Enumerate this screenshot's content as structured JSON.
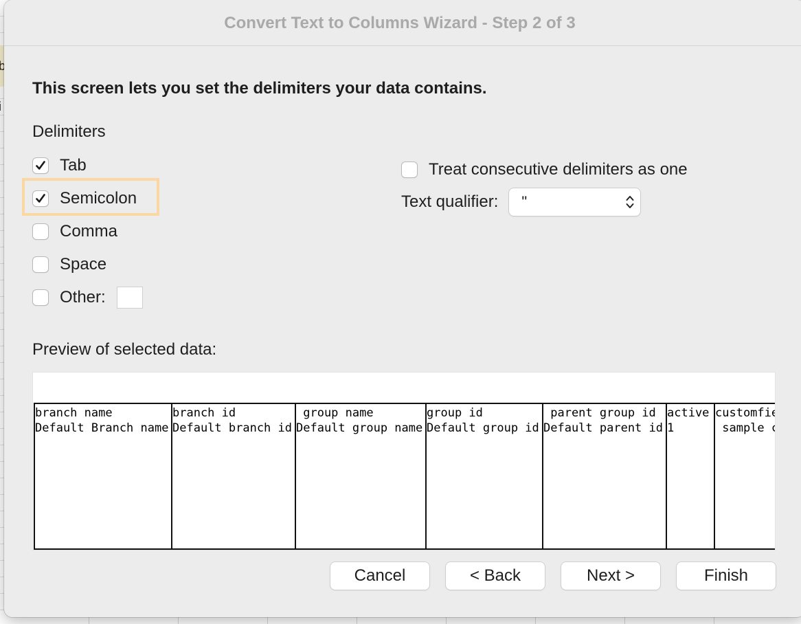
{
  "dialog": {
    "title": "Convert Text to Columns Wizard - Step 2 of 3",
    "heading": "This screen lets you set the delimiters your data contains."
  },
  "delimiters": {
    "label": "Delimiters",
    "items": [
      {
        "label": "Tab",
        "checked": true
      },
      {
        "label": "Semicolon",
        "checked": true,
        "highlighted": true
      },
      {
        "label": "Comma",
        "checked": false
      },
      {
        "label": "Space",
        "checked": false
      },
      {
        "label": "Other:",
        "checked": false,
        "value": ""
      }
    ]
  },
  "options": {
    "consecutive_label": "Treat consecutive delimiters as one",
    "consecutive_checked": false,
    "qualifier_label": "Text qualifier:",
    "qualifier_value": "\""
  },
  "preview": {
    "label": "Preview of selected data:",
    "columns": [
      {
        "header": "branch name",
        "value": "Default Branch name"
      },
      {
        "header": "branch id",
        "value": "Default branch id"
      },
      {
        "header": " group name",
        "value": "Default group name"
      },
      {
        "header": "group id",
        "value": "Default group id"
      },
      {
        "header": " parent group id",
        "value": "Default parent id"
      },
      {
        "header": "active",
        "value": "1"
      },
      {
        "header": "customfie",
        "value": " sample c"
      }
    ]
  },
  "buttons": {
    "cancel": "Cancel",
    "back": "< Back",
    "next": "Next >",
    "finish": "Finish"
  },
  "background": {
    "fragments": [
      "b",
      "i"
    ]
  },
  "colors": {
    "highlight": "#fbd7a3",
    "dialog_bg": "#ececec",
    "title_text": "#a9a9a9"
  }
}
